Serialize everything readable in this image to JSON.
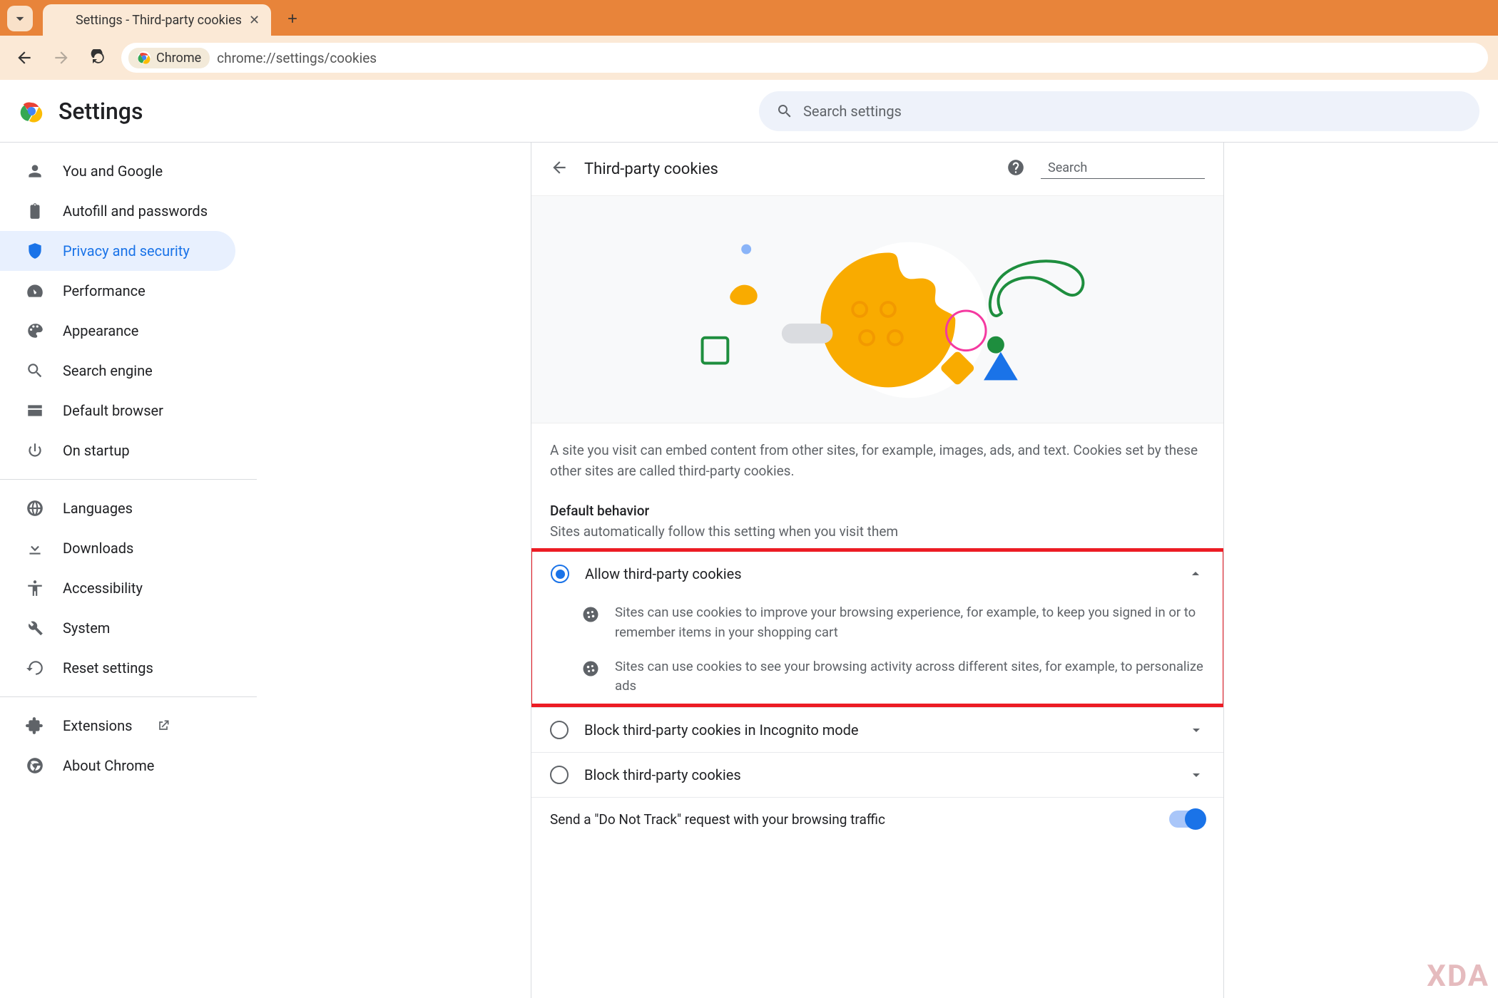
{
  "browser": {
    "tab_title": "Settings - Third-party cookies",
    "chrome_chip": "Chrome",
    "url": "chrome://settings/cookies"
  },
  "header": {
    "title": "Settings",
    "search_placeholder": "Search settings"
  },
  "sidebar": {
    "items": [
      {
        "label": "You and Google"
      },
      {
        "label": "Autofill and passwords"
      },
      {
        "label": "Privacy and security"
      },
      {
        "label": "Performance"
      },
      {
        "label": "Appearance"
      },
      {
        "label": "Search engine"
      },
      {
        "label": "Default browser"
      },
      {
        "label": "On startup"
      }
    ],
    "items2": [
      {
        "label": "Languages"
      },
      {
        "label": "Downloads"
      },
      {
        "label": "Accessibility"
      },
      {
        "label": "System"
      },
      {
        "label": "Reset settings"
      }
    ],
    "items3": [
      {
        "label": "Extensions"
      },
      {
        "label": "About Chrome"
      }
    ]
  },
  "panel": {
    "title": "Third-party cookies",
    "search_placeholder": "Search",
    "description": "A site you visit can embed content from other sites, for example, images, ads, and text. Cookies set by these other sites are called third-party cookies.",
    "section_label": "Default behavior",
    "section_sub": "Sites automatically follow this setting when you visit them",
    "option1": "Allow third-party cookies",
    "bullet1": "Sites can use cookies to improve your browsing experience, for example, to keep you signed in or to remember items in your shopping cart",
    "bullet2": "Sites can use cookies to see your browsing activity across different sites, for example, to personalize ads",
    "option2": "Block third-party cookies in Incognito mode",
    "option3": "Block third-party cookies",
    "dnt": "Send a \"Do Not Track\" request with your browsing traffic"
  },
  "watermark": "XDA"
}
